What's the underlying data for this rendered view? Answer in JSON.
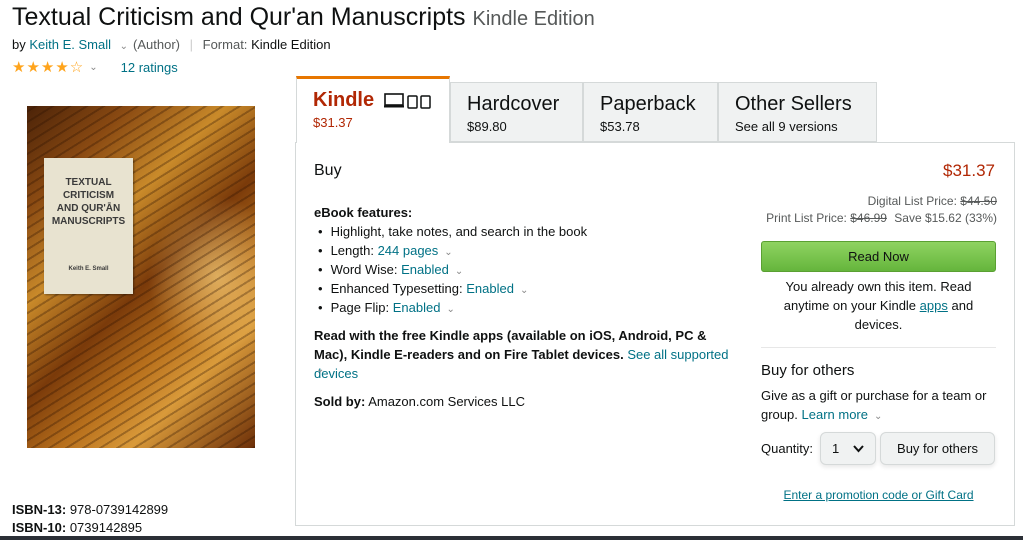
{
  "product": {
    "title": "Textual Criticism and Qur'an Manuscripts",
    "edition": "Kindle Edition",
    "by_prefix": "by",
    "author": "Keith E. Small",
    "author_role": "(Author)",
    "format_label": "Format:",
    "format_value": "Kindle Edition",
    "rating": 4,
    "ratings_count": "12 ratings"
  },
  "cover": {
    "title_line1": "TEXTUAL",
    "title_line2": "CRITICISM",
    "title_line3": "AND QUR'ĀN",
    "title_line4": "MANUSCRIPTS",
    "author": "Keith E. Small"
  },
  "isbn": {
    "isbn13_label": "ISBN-13:",
    "isbn13_value": "978-0739142899",
    "isbn10_label": "ISBN-10:",
    "isbn10_value": "0739142895"
  },
  "tabs": [
    {
      "name": "Kindle",
      "price": "$31.37",
      "selected": true
    },
    {
      "name": "Hardcover",
      "price": "$89.80"
    },
    {
      "name": "Paperback",
      "price": "$53.78"
    },
    {
      "name": "Other Sellers",
      "price": "See all 9 versions"
    }
  ],
  "details": {
    "buy_label": "Buy",
    "features_title": "eBook features:",
    "features": [
      {
        "text": "Highlight, take notes, and search in the book",
        "link": ""
      },
      {
        "text": "Length:",
        "link": "244 pages"
      },
      {
        "text": "Word Wise:",
        "link": "Enabled"
      },
      {
        "text": "Enhanced Typesetting:",
        "link": "Enabled"
      },
      {
        "text": "Page Flip:",
        "link": "Enabled"
      }
    ],
    "apps_text": "Read with the free Kindle apps (available on iOS, Android, PC & Mac), Kindle E-readers and on Fire Tablet devices.",
    "apps_link": "See all supported devices",
    "sold_by_label": "Sold by:",
    "sold_by_value": "Amazon.com Services LLC"
  },
  "buybox": {
    "price": "$31.37",
    "digital_list_label": "Digital List Price:",
    "digital_list_value": "$44.50",
    "print_list_label": "Print List Price:",
    "print_list_value": "$46.99",
    "savings": "Save $15.62 (33%)",
    "read_now": "Read Now",
    "own_text_1": "You already own this item. Read anytime on your Kindle",
    "own_link": "apps",
    "own_text_2": "and devices.",
    "buy_others_title": "Buy for others",
    "gift_text": "Give as a gift or purchase for a team or group.",
    "learn_more": "Learn more",
    "quantity_label": "Quantity:",
    "quantity_value": "1",
    "buy_others_button": "Buy for others",
    "promo_link": "Enter a promotion code or Gift Card"
  },
  "colors": {
    "price_red": "#b12704",
    "link_teal": "#007185",
    "star_orange": "#ffa41c",
    "tab_accent": "#e77600",
    "read_now_green": "#7ac74f"
  }
}
